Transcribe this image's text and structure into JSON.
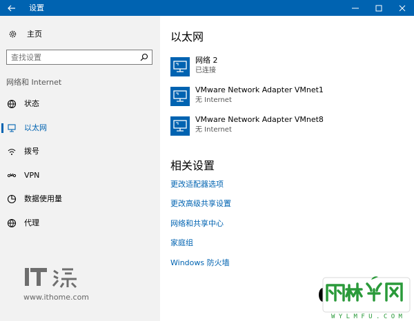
{
  "window": {
    "title": "设置"
  },
  "sidebar": {
    "home_label": "主页",
    "search_placeholder": "查找设置",
    "category": "网络和 Internet",
    "items": [
      {
        "label": "状态",
        "icon": "globe-status-icon"
      },
      {
        "label": "以太网",
        "icon": "ethernet-icon",
        "active": true
      },
      {
        "label": "拨号",
        "icon": "dialup-icon"
      },
      {
        "label": "VPN",
        "icon": "vpn-icon"
      },
      {
        "label": "数据使用量",
        "icon": "data-usage-icon"
      },
      {
        "label": "代理",
        "icon": "proxy-globe-icon"
      }
    ]
  },
  "main": {
    "title": "以太网",
    "adapters": [
      {
        "name": "网络  2",
        "status": "已连接"
      },
      {
        "name": "VMware Network Adapter VMnet1",
        "status": "无 Internet"
      },
      {
        "name": "VMware Network Adapter VMnet8",
        "status": "无 Internet"
      }
    ],
    "related_title": "相关设置",
    "related_links": [
      "更改适配器选项",
      "更改高级共享设置",
      "网络和共享中心",
      "家庭组",
      "Windows 防火墙"
    ]
  },
  "watermarks": {
    "ithome_logo": "IT之家",
    "ithome_url": "www.ithome.com",
    "ylmfu_logo": "雨林木风",
    "ylmfu_url": "W Y L M F U . C O M"
  },
  "colors": {
    "accent": "#0063b1",
    "sidebar_bg": "#f2f2f2",
    "title_bar": "#0063b1"
  }
}
